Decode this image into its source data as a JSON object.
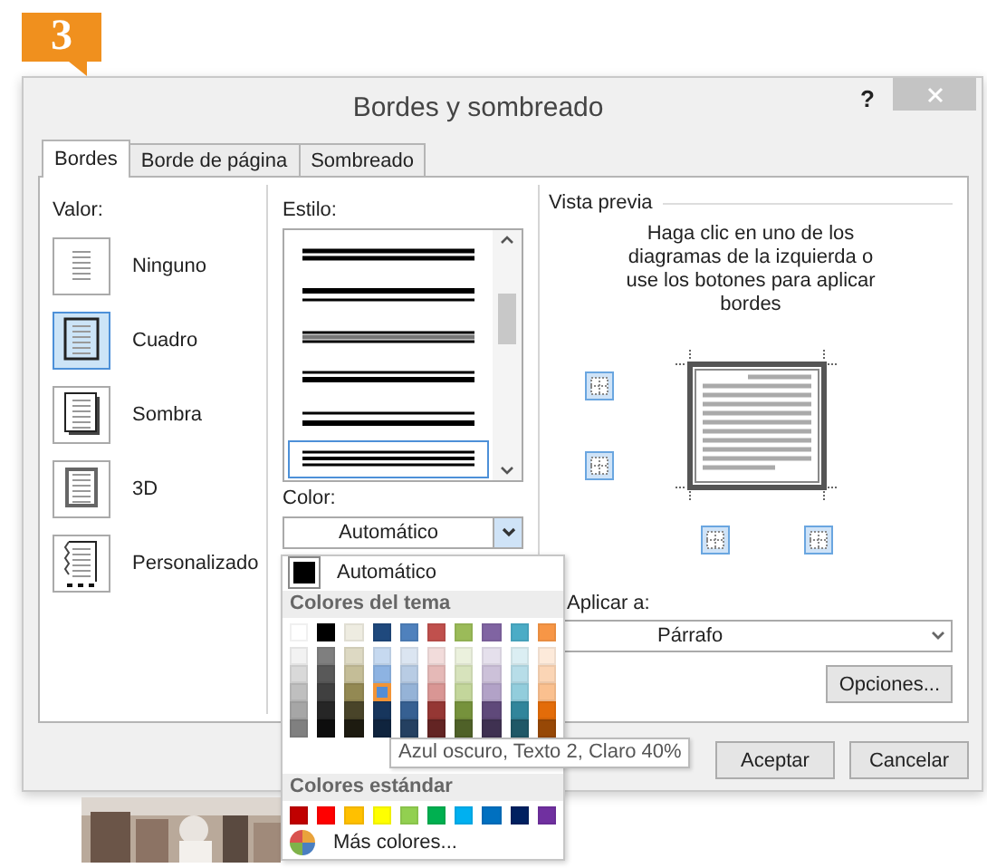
{
  "step_badge": "3",
  "window": {
    "title": "Bordes y sombreado",
    "help": "?"
  },
  "tabs": [
    {
      "label": "Bordes",
      "selected": true
    },
    {
      "label": "Borde de página",
      "selected": false
    },
    {
      "label": "Sombreado",
      "selected": false
    }
  ],
  "valor": {
    "label": "Valor:",
    "items": [
      {
        "label": "Ninguno",
        "kind": "none",
        "selected": false
      },
      {
        "label": "Cuadro",
        "kind": "box",
        "selected": true
      },
      {
        "label": "Sombra",
        "kind": "shadow",
        "selected": false
      },
      {
        "label": "3D",
        "kind": "raised",
        "selected": false
      },
      {
        "label": "Personalizado",
        "kind": "custom",
        "selected": false
      }
    ]
  },
  "estilo": {
    "label": "Estilo:",
    "styles": [
      {
        "kind": "double",
        "selected": false
      },
      {
        "kind": "thick-thin",
        "selected": false
      },
      {
        "kind": "gray-band",
        "selected": false
      },
      {
        "kind": "thin-thick",
        "selected": false
      },
      {
        "kind": "thin-thick-wide",
        "selected": false
      },
      {
        "kind": "triple",
        "selected": true
      }
    ]
  },
  "color": {
    "label": "Color:",
    "value": "Automático"
  },
  "color_menu": {
    "automatic": "Automático",
    "theme_header": "Colores del tema",
    "theme_base": [
      {
        "color": "#ffffff",
        "selected": false
      },
      {
        "color": "#000000",
        "selected": false
      },
      {
        "color": "#eeece1",
        "selected": false
      },
      {
        "color": "#1f497d",
        "selected": false
      },
      {
        "color": "#4f81bd",
        "selected": false
      },
      {
        "color": "#c0504d",
        "selected": false
      },
      {
        "color": "#9bbb59",
        "selected": false
      },
      {
        "color": "#8064a2",
        "selected": false
      },
      {
        "color": "#4bacc6",
        "selected": false
      },
      {
        "color": "#f79646",
        "selected": false
      }
    ],
    "theme_shades": [
      [
        {
          "color": "#f2f2f2",
          "selected": false
        },
        {
          "color": "#7f7f7f",
          "selected": false
        },
        {
          "color": "#ddd9c3",
          "selected": false
        },
        {
          "color": "#c6d9f0",
          "selected": false
        },
        {
          "color": "#dbe5f1",
          "selected": false
        },
        {
          "color": "#f2dcdb",
          "selected": false
        },
        {
          "color": "#ebf1dd",
          "selected": false
        },
        {
          "color": "#e5e0ec",
          "selected": false
        },
        {
          "color": "#dbeef3",
          "selected": false
        },
        {
          "color": "#fdeada",
          "selected": false
        }
      ],
      [
        {
          "color": "#d9d9d9",
          "selected": false
        },
        {
          "color": "#595959",
          "selected": false
        },
        {
          "color": "#c4bd97",
          "selected": false
        },
        {
          "color": "#8db3e2",
          "selected": false
        },
        {
          "color": "#b8cce4",
          "selected": false
        },
        {
          "color": "#e5b9b7",
          "selected": false
        },
        {
          "color": "#d7e3bc",
          "selected": false
        },
        {
          "color": "#ccc1d9",
          "selected": false
        },
        {
          "color": "#b7dde8",
          "selected": false
        },
        {
          "color": "#fbd5b5",
          "selected": false
        }
      ],
      [
        {
          "color": "#bfbfbf",
          "selected": false
        },
        {
          "color": "#404040",
          "selected": false
        },
        {
          "color": "#938953",
          "selected": false
        },
        {
          "color": "#548dd4",
          "selected": true
        },
        {
          "color": "#95b3d7",
          "selected": false
        },
        {
          "color": "#d99694",
          "selected": false
        },
        {
          "color": "#c3d69b",
          "selected": false
        },
        {
          "color": "#b2a2c7",
          "selected": false
        },
        {
          "color": "#92cddc",
          "selected": false
        },
        {
          "color": "#fac08f",
          "selected": false
        }
      ],
      [
        {
          "color": "#a6a6a6",
          "selected": false
        },
        {
          "color": "#262626",
          "selected": false
        },
        {
          "color": "#494429",
          "selected": false
        },
        {
          "color": "#17365d",
          "selected": false
        },
        {
          "color": "#366092",
          "selected": false
        },
        {
          "color": "#953734",
          "selected": false
        },
        {
          "color": "#76923c",
          "selected": false
        },
        {
          "color": "#5f497a",
          "selected": false
        },
        {
          "color": "#31859b",
          "selected": false
        },
        {
          "color": "#e36c09",
          "selected": false
        }
      ],
      [
        {
          "color": "#808080",
          "selected": false
        },
        {
          "color": "#0d0d0d",
          "selected": false
        },
        {
          "color": "#1d1b10",
          "selected": false
        },
        {
          "color": "#0f243e",
          "selected": false
        },
        {
          "color": "#244061",
          "selected": false
        },
        {
          "color": "#632423",
          "selected": false
        },
        {
          "color": "#4f6128",
          "selected": false
        },
        {
          "color": "#3f3151",
          "selected": false
        },
        {
          "color": "#205867",
          "selected": false
        },
        {
          "color": "#974806",
          "selected": false
        }
      ]
    ],
    "standard_header": "Colores estándar",
    "standard": [
      {
        "color": "#c00000",
        "selected": false
      },
      {
        "color": "#ff0000",
        "selected": false
      },
      {
        "color": "#ffc000",
        "selected": false
      },
      {
        "color": "#ffff00",
        "selected": false
      },
      {
        "color": "#92d050",
        "selected": false
      },
      {
        "color": "#00b050",
        "selected": false
      },
      {
        "color": "#00b0f0",
        "selected": false
      },
      {
        "color": "#0070c0",
        "selected": false
      },
      {
        "color": "#002060",
        "selected": false
      },
      {
        "color": "#7030a0",
        "selected": false
      }
    ],
    "more": "Más colores...",
    "tooltip": "Azul oscuro, Texto 2, Claro 40%"
  },
  "preview": {
    "label": "Vista previa",
    "instructions": "Haga clic en uno de los diagramas de la izquierda o use los botones para aplicar bordes"
  },
  "apply_to": {
    "label": "Aplicar a:",
    "value": "Párrafo"
  },
  "options_button": "Opciones...",
  "buttons": [
    "Aceptar",
    "Cancelar"
  ],
  "photo": {
    "kind": "picture"
  }
}
